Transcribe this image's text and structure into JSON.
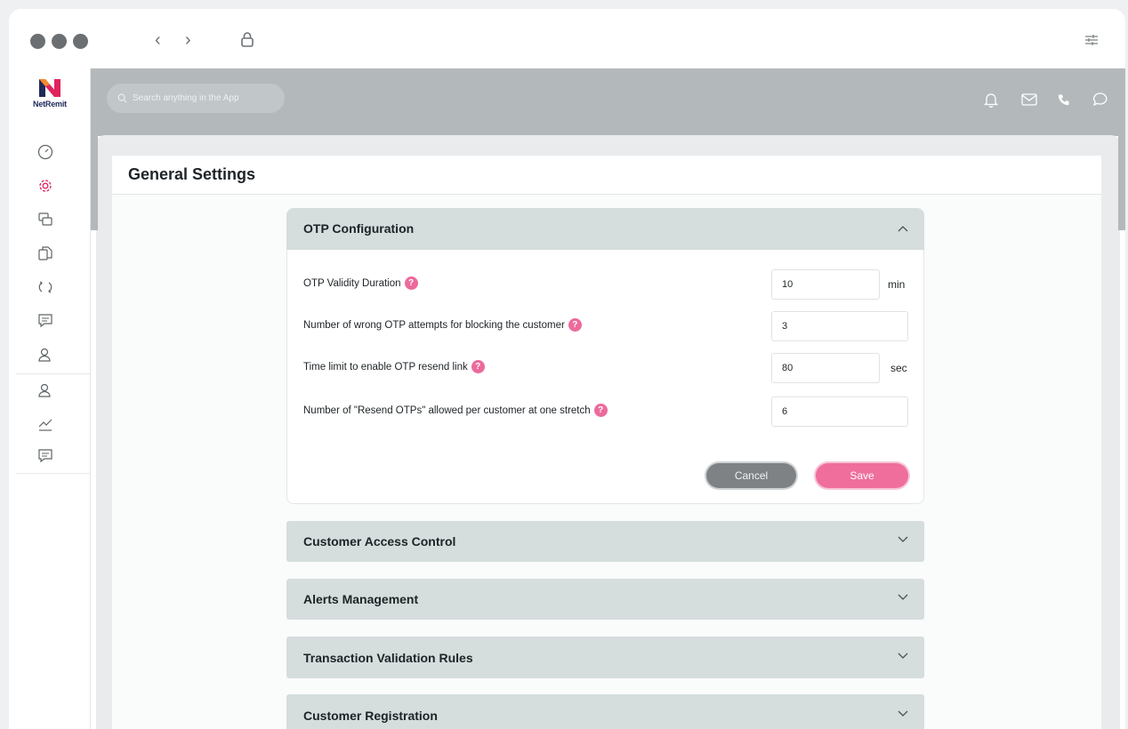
{
  "app": {
    "brand": "NetRemit",
    "brand_color": "#e0245e"
  },
  "search": {
    "placeholder": "Search anything in the App"
  },
  "page": {
    "title": "General Settings"
  },
  "otp": {
    "title": "OTP Configuration",
    "rows": [
      {
        "label": "OTP Validity Duration",
        "value": "10",
        "unit": "min"
      },
      {
        "label": "Number of wrong OTP attempts for blocking the customer",
        "value": "3",
        "unit": ""
      },
      {
        "label": "Time limit to enable OTP resend link",
        "value": "80",
        "unit": "sec"
      },
      {
        "label": "Number of \"Resend OTPs\" allowed per customer at one stretch",
        "value": "6",
        "unit": ""
      }
    ],
    "help_glyph": "?",
    "cancel_label": "Cancel",
    "save_label": "Save"
  },
  "sections": [
    {
      "title": "Customer Access Control"
    },
    {
      "title": "Alerts Management"
    },
    {
      "title": "Transaction Validation Rules"
    },
    {
      "title": "Customer Registration"
    }
  ],
  "icons": {
    "chrome": [
      "window-close-dot",
      "window-minimize-dot",
      "window-zoom-dot",
      "back-arrow-icon",
      "forward-arrow-icon",
      "lock-icon",
      "sliders-icon"
    ],
    "sidebar": [
      "dashboard-icon",
      "gear-icon",
      "layers-icon",
      "documents-icon",
      "sync-icon",
      "message-icon",
      "user-icon",
      "user-group-icon",
      "chart-icon",
      "chat-icon"
    ],
    "topbar": [
      "bell-icon",
      "mail-icon",
      "phone-icon",
      "chat-bubble-icon"
    ]
  },
  "colors": {
    "accent": "#ef6e9c",
    "active_icon": "#e0245e",
    "topbar": "#b3b9bb",
    "accordion": "#d5dddd"
  }
}
